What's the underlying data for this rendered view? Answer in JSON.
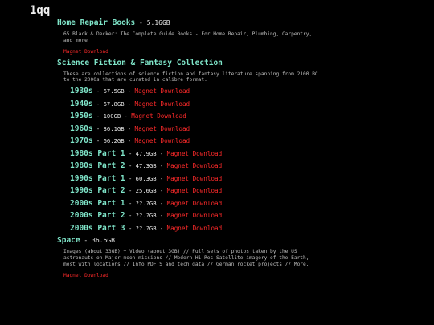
{
  "site": {
    "title": "1qq"
  },
  "sections": [
    {
      "title": "Home Repair Books",
      "size": "5.16GB",
      "description": "65 Black & Decker: The Complete Guide Books - For Home Repair, Plumbing, Carpentry, and more",
      "link": "Magnet Download"
    },
    {
      "title": "Science Fiction & Fantasy Collection",
      "description": "These are collections of science fiction and fantasy literature spanning from 2100 BC to the 2000s that are curated in calibre format.",
      "items": [
        {
          "era": "1930s",
          "size": "67.5GB",
          "link": "Magnet Download"
        },
        {
          "era": "1940s",
          "size": "67.8GB",
          "link": "Magnet Download"
        },
        {
          "era": "1950s",
          "size": "100GB",
          "link": "Magnet Download"
        },
        {
          "era": "1960s",
          "size": "36.1GB",
          "link": "Magnet Download"
        },
        {
          "era": "1970s",
          "size": "66.2GB",
          "link": "Magnet Download"
        },
        {
          "era": "1980s Part 1",
          "size": "47.9GB",
          "link": "Magnet Download"
        },
        {
          "era": "1980s Part 2",
          "size": "47.3GB",
          "link": "Magnet Download"
        },
        {
          "era": "1990s Part 1",
          "size": "60.3GB",
          "link": "Magnet Download"
        },
        {
          "era": "1990s Part 2",
          "size": "25.6GB",
          "link": "Magnet Download"
        },
        {
          "era": "2000s Part 1",
          "size": "??.?GB",
          "link": "Magnet Download"
        },
        {
          "era": "2000s Part 2",
          "size": "??.?GB",
          "link": "Magnet Download"
        },
        {
          "era": "2000s Part 3",
          "size": "??.?GB",
          "link": "Magnet Download"
        }
      ]
    },
    {
      "title": "Space",
      "size": "36.6GB",
      "description": "Images (about 33GB) + Video (about 3GB) // Full sets of photos taken by the US astronauts on Major moon missions // Modern Hi-Res Satellite imagery of the Earth, most with locations // Info PDF'S and tech data // German rocket projects // More.",
      "link": "Magnet Download"
    }
  ],
  "separator": " - ",
  "colors": {
    "background": "#000000",
    "heading": "#7fe5c9",
    "link": "#ff2a2a",
    "text": "#bdbdbd"
  }
}
